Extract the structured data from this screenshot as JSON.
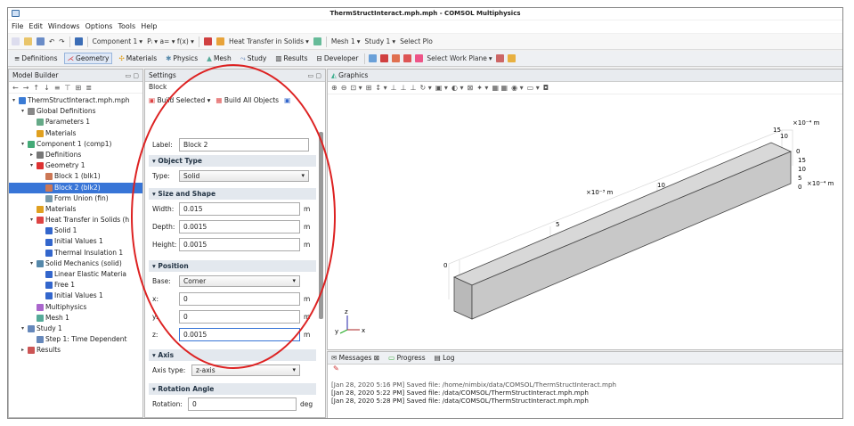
{
  "window": {
    "title": "ThermStructInteract.mph.mph - COMSOL Multiphysics"
  },
  "menu": [
    "File",
    "Edit",
    "Windows",
    "Options",
    "Tools",
    "Help"
  ],
  "toolbar": {
    "component": "Component 1",
    "heat_transfer": "Heat Transfer in Solids",
    "mesh": "Mesh 1",
    "study": "Study 1",
    "select_plot": "Select Plo"
  },
  "ribbon": {
    "tabs": [
      "Definitions",
      "Geometry",
      "Materials",
      "Physics",
      "Mesh",
      "Study",
      "Results",
      "Developer"
    ],
    "active_tab": "Geometry",
    "select_work_plane": "Select Work Plane"
  },
  "model_builder": {
    "title": "Model Builder",
    "tree": [
      {
        "label": "ThermStructInteract.mph.mph",
        "depth": 0,
        "twist": "▾",
        "icon": "#3a7bd5"
      },
      {
        "label": "Global Definitions",
        "depth": 1,
        "twist": "▾",
        "icon": "#888"
      },
      {
        "label": "Parameters 1",
        "depth": 2,
        "twist": "",
        "icon": "#6a8"
      },
      {
        "label": "Materials",
        "depth": 2,
        "twist": "",
        "icon": "#e0a020"
      },
      {
        "label": "Component 1 (comp1)",
        "depth": 1,
        "twist": "▾",
        "icon": "#4a7"
      },
      {
        "label": "Definitions",
        "depth": 2,
        "twist": "▸",
        "icon": "#777"
      },
      {
        "label": "Geometry 1",
        "depth": 2,
        "twist": "▾",
        "icon": "#d33"
      },
      {
        "label": "Block 1 (blk1)",
        "depth": 3,
        "twist": "",
        "icon": "#c75"
      },
      {
        "label": "Block 2 (blk2)",
        "depth": 3,
        "twist": "",
        "icon": "#c75",
        "selected": true
      },
      {
        "label": "Form Union (fin)",
        "depth": 3,
        "twist": "",
        "icon": "#79a"
      },
      {
        "label": "Materials",
        "depth": 2,
        "twist": "",
        "icon": "#e0a020"
      },
      {
        "label": "Heat Transfer in Solids (h",
        "depth": 2,
        "twist": "▾",
        "icon": "#d44"
      },
      {
        "label": "Solid 1",
        "depth": 3,
        "twist": "",
        "icon": "#36c"
      },
      {
        "label": "Initial Values 1",
        "depth": 3,
        "twist": "",
        "icon": "#36c"
      },
      {
        "label": "Thermal Insulation 1",
        "depth": 3,
        "twist": "",
        "icon": "#36c"
      },
      {
        "label": "Solid Mechanics (solid)",
        "depth": 2,
        "twist": "▾",
        "icon": "#58a"
      },
      {
        "label": "Linear Elastic Materia",
        "depth": 3,
        "twist": "",
        "icon": "#36c"
      },
      {
        "label": "Free 1",
        "depth": 3,
        "twist": "",
        "icon": "#36c"
      },
      {
        "label": "Initial Values 1",
        "depth": 3,
        "twist": "",
        "icon": "#36c"
      },
      {
        "label": "Multiphysics",
        "depth": 2,
        "twist": "",
        "icon": "#a6c"
      },
      {
        "label": "Mesh 1",
        "depth": 2,
        "twist": "",
        "icon": "#5a9"
      },
      {
        "label": "Study 1",
        "depth": 1,
        "twist": "▾",
        "icon": "#68b"
      },
      {
        "label": "Step 1: Time Dependent",
        "depth": 2,
        "twist": "",
        "icon": "#68b"
      },
      {
        "label": "Results",
        "depth": 1,
        "twist": "▸",
        "icon": "#c55"
      }
    ]
  },
  "settings": {
    "title": "Settings",
    "subtitle": "Block",
    "build_selected": "Build Selected",
    "build_all": "Build All Objects",
    "label_caption": "Label:",
    "label_value": "Block 2",
    "object_type": {
      "header": "Object Type",
      "type_caption": "Type:",
      "type_value": "Solid"
    },
    "size_shape": {
      "header": "Size and Shape",
      "width_caption": "Width:",
      "width_value": "0.015",
      "depth_caption": "Depth:",
      "depth_value": "0.0015",
      "height_caption": "Height:",
      "height_value": "0.0015",
      "unit": "m"
    },
    "position": {
      "header": "Position",
      "base_caption": "Base:",
      "base_value": "Corner",
      "x_caption": "x:",
      "x_value": "0",
      "y_caption": "y:",
      "y_value": "0",
      "z_caption": "z:",
      "z_value": "0.0015",
      "unit": "m"
    },
    "axis": {
      "header": "Axis",
      "axis_type_caption": "Axis type:",
      "axis_type_value": "z-axis"
    },
    "rotation": {
      "header": "Rotation Angle",
      "rotation_caption": "Rotation:",
      "rotation_value": "0",
      "unit": "deg"
    }
  },
  "graphics": {
    "title": "Graphics",
    "labels": {
      "x_scale": "×10⁻³ m",
      "tick_0": "0",
      "tick_5": "5",
      "tick_10": "10",
      "tick_15": "15",
      "tick_10b": "10",
      "top_scale": "×10⁻⁴ m",
      "right_scale": "×10⁻⁴ m",
      "rtick_0": "0",
      "rtick_5": "5",
      "rtick_10": "10",
      "rtick_15": "15"
    },
    "triad": {
      "x": "x",
      "y": "y",
      "z": "z"
    }
  },
  "messages": {
    "tabs": [
      "Messages",
      "Progress",
      "Log"
    ],
    "lines": [
      "[Jan 28, 2020 5:16 PM] Saved file: /home/nimbix/data/COMSOL/ThermStructInteract.mph",
      "[Jan 28, 2020 5:22 PM] Saved file: /data/COMSOL/ThermStructInteract.mph.mph",
      "[Jan 28, 2020 5:28 PM] Saved file: /data/COMSOL/ThermStructInteract.mph.mph"
    ]
  },
  "colors": {
    "highlight_oval": "#dd2222",
    "selection": "#3875d7",
    "block_face": "#c8c8c8"
  }
}
